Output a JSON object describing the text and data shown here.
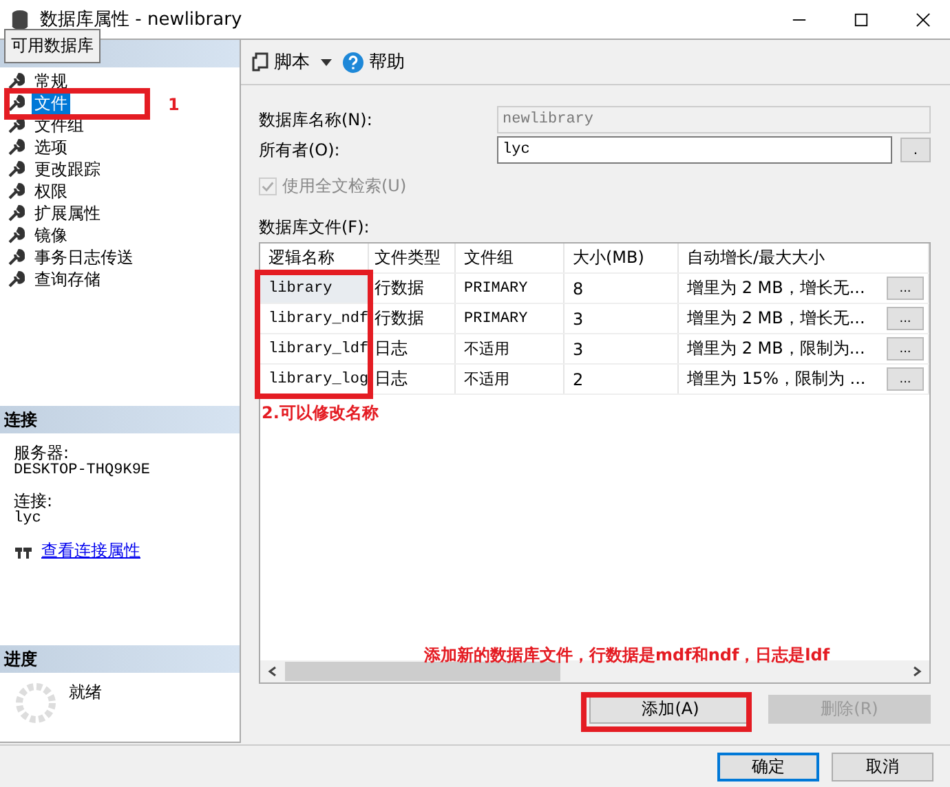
{
  "window": {
    "title": "数据库属性 - newlibrary",
    "tooltip": "可用数据库"
  },
  "pages": [
    {
      "label": "常规",
      "selected": false
    },
    {
      "label": "文件",
      "selected": true
    },
    {
      "label": "文件组",
      "selected": false
    },
    {
      "label": "选项",
      "selected": false
    },
    {
      "label": "更改跟踪",
      "selected": false
    },
    {
      "label": "权限",
      "selected": false
    },
    {
      "label": "扩展属性",
      "selected": false
    },
    {
      "label": "镜像",
      "selected": false
    },
    {
      "label": "事务日志传送",
      "selected": false
    },
    {
      "label": "查询存储",
      "selected": false
    }
  ],
  "connection": {
    "title": "连接",
    "server_label": "服务器:",
    "server": "DESKTOP-THQ9K9E",
    "conn_label": "连接:",
    "conn": "lyc",
    "link": "查看连接属性"
  },
  "progress": {
    "title": "进度",
    "status": "就绪"
  },
  "toolbar": {
    "script": "脚本",
    "help": "帮助"
  },
  "form": {
    "name_label": "数据库名称(N):",
    "name_value": "newlibrary",
    "owner_label": "所有者(O):",
    "owner_value": "lyc",
    "owner_button": ".",
    "fulltext_label": "使用全文检索(U)",
    "fulltext_checked": true,
    "fulltext_disabled": true,
    "files_label": "数据库文件(F):"
  },
  "table": {
    "columns": [
      "逻辑名称",
      "文件类型",
      "文件组",
      "大小(MB)",
      "自动增长/最大大小"
    ],
    "rows": [
      {
        "cells": [
          "library",
          "行数据",
          "PRIMARY",
          "8",
          "增里为 2 MB，增长无..."
        ],
        "button": "...",
        "selected": true
      },
      {
        "cells": [
          "library_ndf",
          "行数据",
          "PRIMARY",
          "3",
          "增里为 2 MB，增长无..."
        ],
        "button": "...",
        "selected": false
      },
      {
        "cells": [
          "library_ldf",
          "日志",
          "不适用",
          "3",
          "增里为 2 MB，限制为..."
        ],
        "button": "...",
        "selected": false
      },
      {
        "cells": [
          "library_log",
          "日志",
          "不适用",
          "2",
          "增里为 15%，限制为 ..."
        ],
        "button": "...",
        "selected": false
      }
    ]
  },
  "buttons": [
    {
      "label": "添加(A)",
      "disabled": false
    },
    {
      "label": "删除(R)",
      "disabled": true
    }
  ],
  "dialog_buttons": [
    {
      "label": "确定",
      "selected": true
    },
    {
      "label": "取消",
      "selected": false
    }
  ],
  "annotations": [
    "1",
    "2.可以修改名称",
    "添加新的数据库文件，行数据是mdf和ndf，日志是ldf"
  ]
}
